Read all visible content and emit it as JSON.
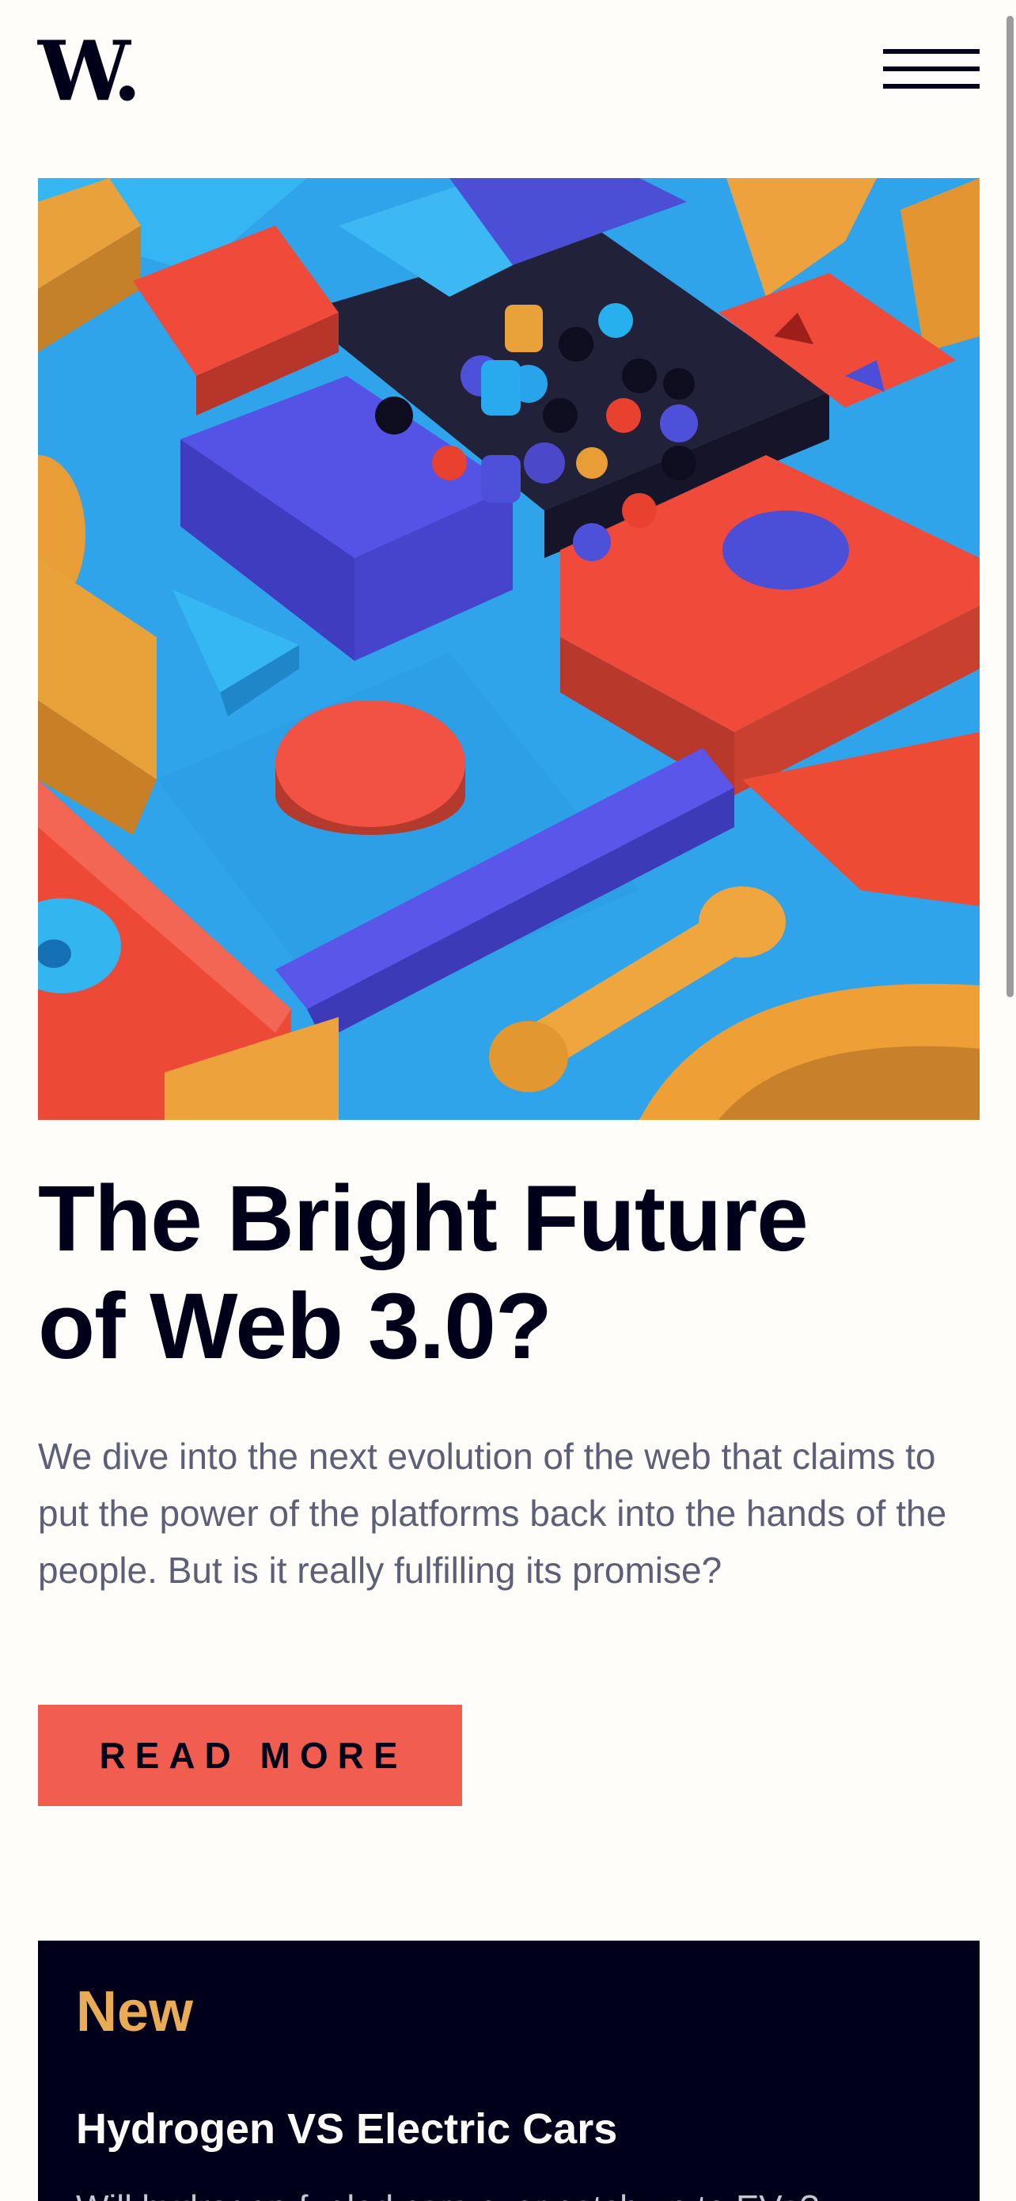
{
  "header": {
    "logo_text": "W.",
    "menu_icon": "hamburger-icon"
  },
  "hero": {
    "image_description_icon": "abstract-3d-blocks-image"
  },
  "article": {
    "title_line1": "The Bright Future",
    "title_line2": "of Web 3.0?",
    "intro": "We dive into the next evolution of the web that claims to put the power of the platforms back into the hands of the people. But is it really fulfilling its promise?",
    "cta_label": "READ MORE"
  },
  "new_panel": {
    "heading": "New",
    "items": [
      {
        "title": "Hydrogen VS Electric Cars",
        "description": "Will hydrogen-fueled cars ever catch up to EVs?"
      }
    ]
  },
  "colors": {
    "background": "#fffdfa",
    "dark": "#00001a",
    "accent_red": "#f15e50",
    "accent_orange": "#e9ab53",
    "text_muted": "#5d5f79"
  }
}
